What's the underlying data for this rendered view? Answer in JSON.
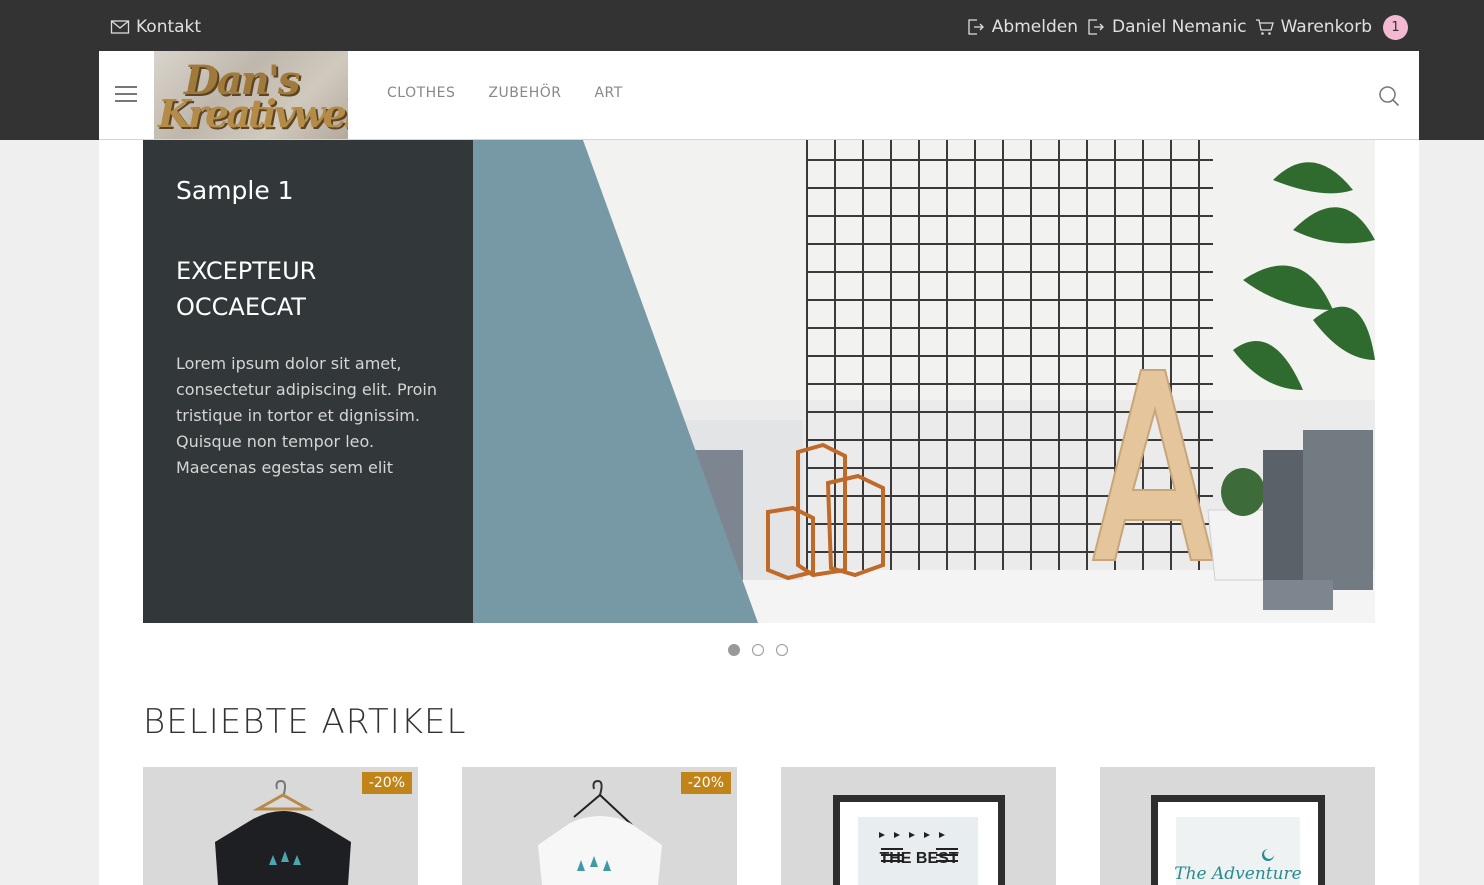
{
  "topbar": {
    "contact_label": "Kontakt",
    "logout_label": "Abmelden",
    "user_name": "Daniel Nemanic",
    "cart_label": "Warenkorb",
    "cart_count": "1"
  },
  "nav": {
    "logo_line1": "Dan's",
    "logo_line2": "Kreativwelt",
    "links": [
      "CLOTHES",
      "ZUBEHÖR",
      "ART"
    ]
  },
  "slider": {
    "title": "Sample 1",
    "heading": "EXCEPTEUR OCCAECAT",
    "text": "Lorem ipsum dolor sit amet, consectetur adipiscing elit. Proin tristique in tortor et dignissim. Quisque non tempor leo. Maecenas egestas sem elit",
    "active_slide": 1,
    "slide_count": 3
  },
  "popular": {
    "title": "BELIEBTE ARTIKEL",
    "products": [
      {
        "discount": "-20%"
      },
      {
        "discount": "-20%"
      },
      {
        "discount": ""
      },
      {
        "discount": ""
      }
    ],
    "frame3_text": "THE BEST",
    "frame4_text": "The Adventure"
  },
  "colors": {
    "topbar_bg": "#333333",
    "badge_bg": "#f3b9d1",
    "caption_bg": "#32373a",
    "slate_blue": "#7799a6",
    "discount_bg": "#c08418"
  }
}
